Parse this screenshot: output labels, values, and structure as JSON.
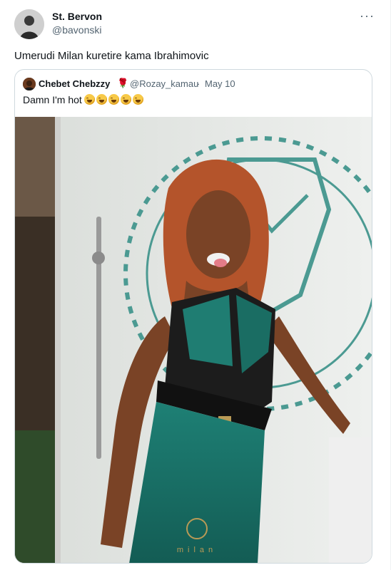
{
  "author": {
    "name": "St. Bervon",
    "handle": "@bavonski"
  },
  "more_label": "···",
  "tweet_text": "Umerudi Milan kuretire kama Ibrahimovic",
  "quoted": {
    "name": "Chebet Chebzzy",
    "badge_emoji": "🌹",
    "handle": "@Rozay_kamau",
    "separator": "·",
    "date": "May 10",
    "text": "Damn I'm hot",
    "emoji_count": 5,
    "emoji_name": "grinning-sweat"
  },
  "photo": {
    "watermark": "milan"
  },
  "colors": {
    "teal": "#1f7d72",
    "wall": "#e9ecea",
    "hair": "#b4542b"
  }
}
